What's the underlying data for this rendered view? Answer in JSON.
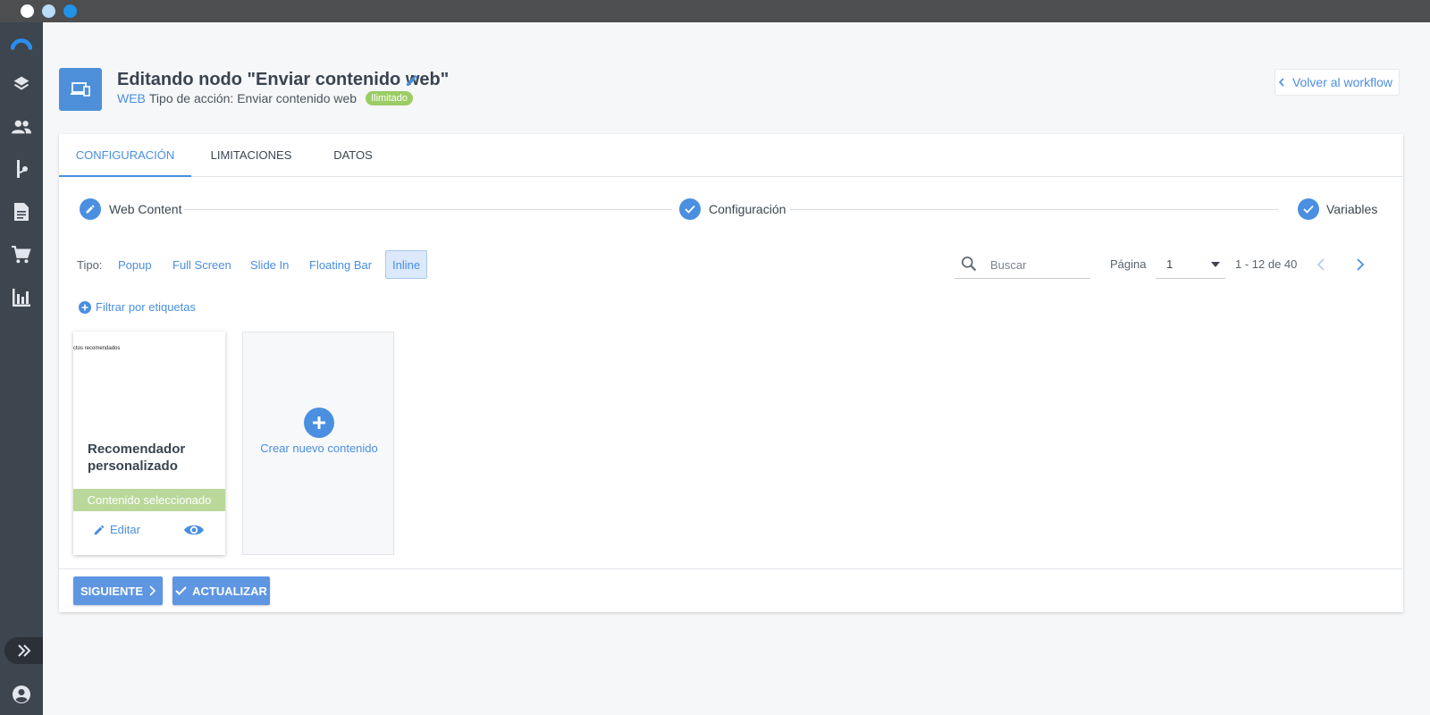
{
  "window": {
    "controls": [
      "close",
      "minimize",
      "maximize"
    ]
  },
  "sidebar": {
    "items": [
      {
        "name": "logo-icon"
      },
      {
        "name": "layers-icon"
      },
      {
        "name": "users-icon"
      },
      {
        "name": "workflow-icon"
      },
      {
        "name": "document-icon"
      },
      {
        "name": "cart-icon"
      },
      {
        "name": "analytics-icon"
      }
    ],
    "expand_icon": "double-chevron-right-icon",
    "user_icon": "user-account-icon"
  },
  "header": {
    "title": "Editando nodo \"Enviar contenido web\"",
    "channel": "WEB",
    "action_type": "Tipo de acción: Enviar contenido web",
    "badge": "Ilimitado",
    "back_label": "Volver al workflow"
  },
  "tabs": [
    {
      "label": "CONFIGURACIÓN",
      "active": true
    },
    {
      "label": "LIMITACIONES",
      "active": false
    },
    {
      "label": "DATOS",
      "active": false
    }
  ],
  "stepper": [
    {
      "label": "Web Content",
      "icon": "pencil-icon"
    },
    {
      "label": "Configuración",
      "icon": "check-icon"
    },
    {
      "label": "Variables",
      "icon": "check-icon"
    }
  ],
  "filters": {
    "tipo_label": "Tipo:",
    "options": [
      {
        "label": "Popup",
        "active": false
      },
      {
        "label": "Full Screen",
        "active": false
      },
      {
        "label": "Slide In",
        "active": false
      },
      {
        "label": "Floating Bar",
        "active": false
      },
      {
        "label": "Inline",
        "active": true
      }
    ],
    "search_placeholder": "Buscar",
    "page_label": "Página",
    "page_value": "1",
    "range": "1 - 12 de 40",
    "tag_filter_label": "Filtrar por etiquetas"
  },
  "contents": [
    {
      "preview_text": "ctos recomendados",
      "title": "Recomendador personalizado",
      "status": "Contenido seleccionado",
      "edit_label": "Editar"
    }
  ],
  "new_content_label": "Crear nuevo contenido",
  "footer": {
    "next_label": "SIGUIENTE",
    "update_label": "ACTUALIZAR"
  },
  "colors": {
    "accent": "#4a8fe0",
    "sidebar": "#3d454e",
    "badge": "#9ccc65",
    "selected": "#b9d89a"
  }
}
